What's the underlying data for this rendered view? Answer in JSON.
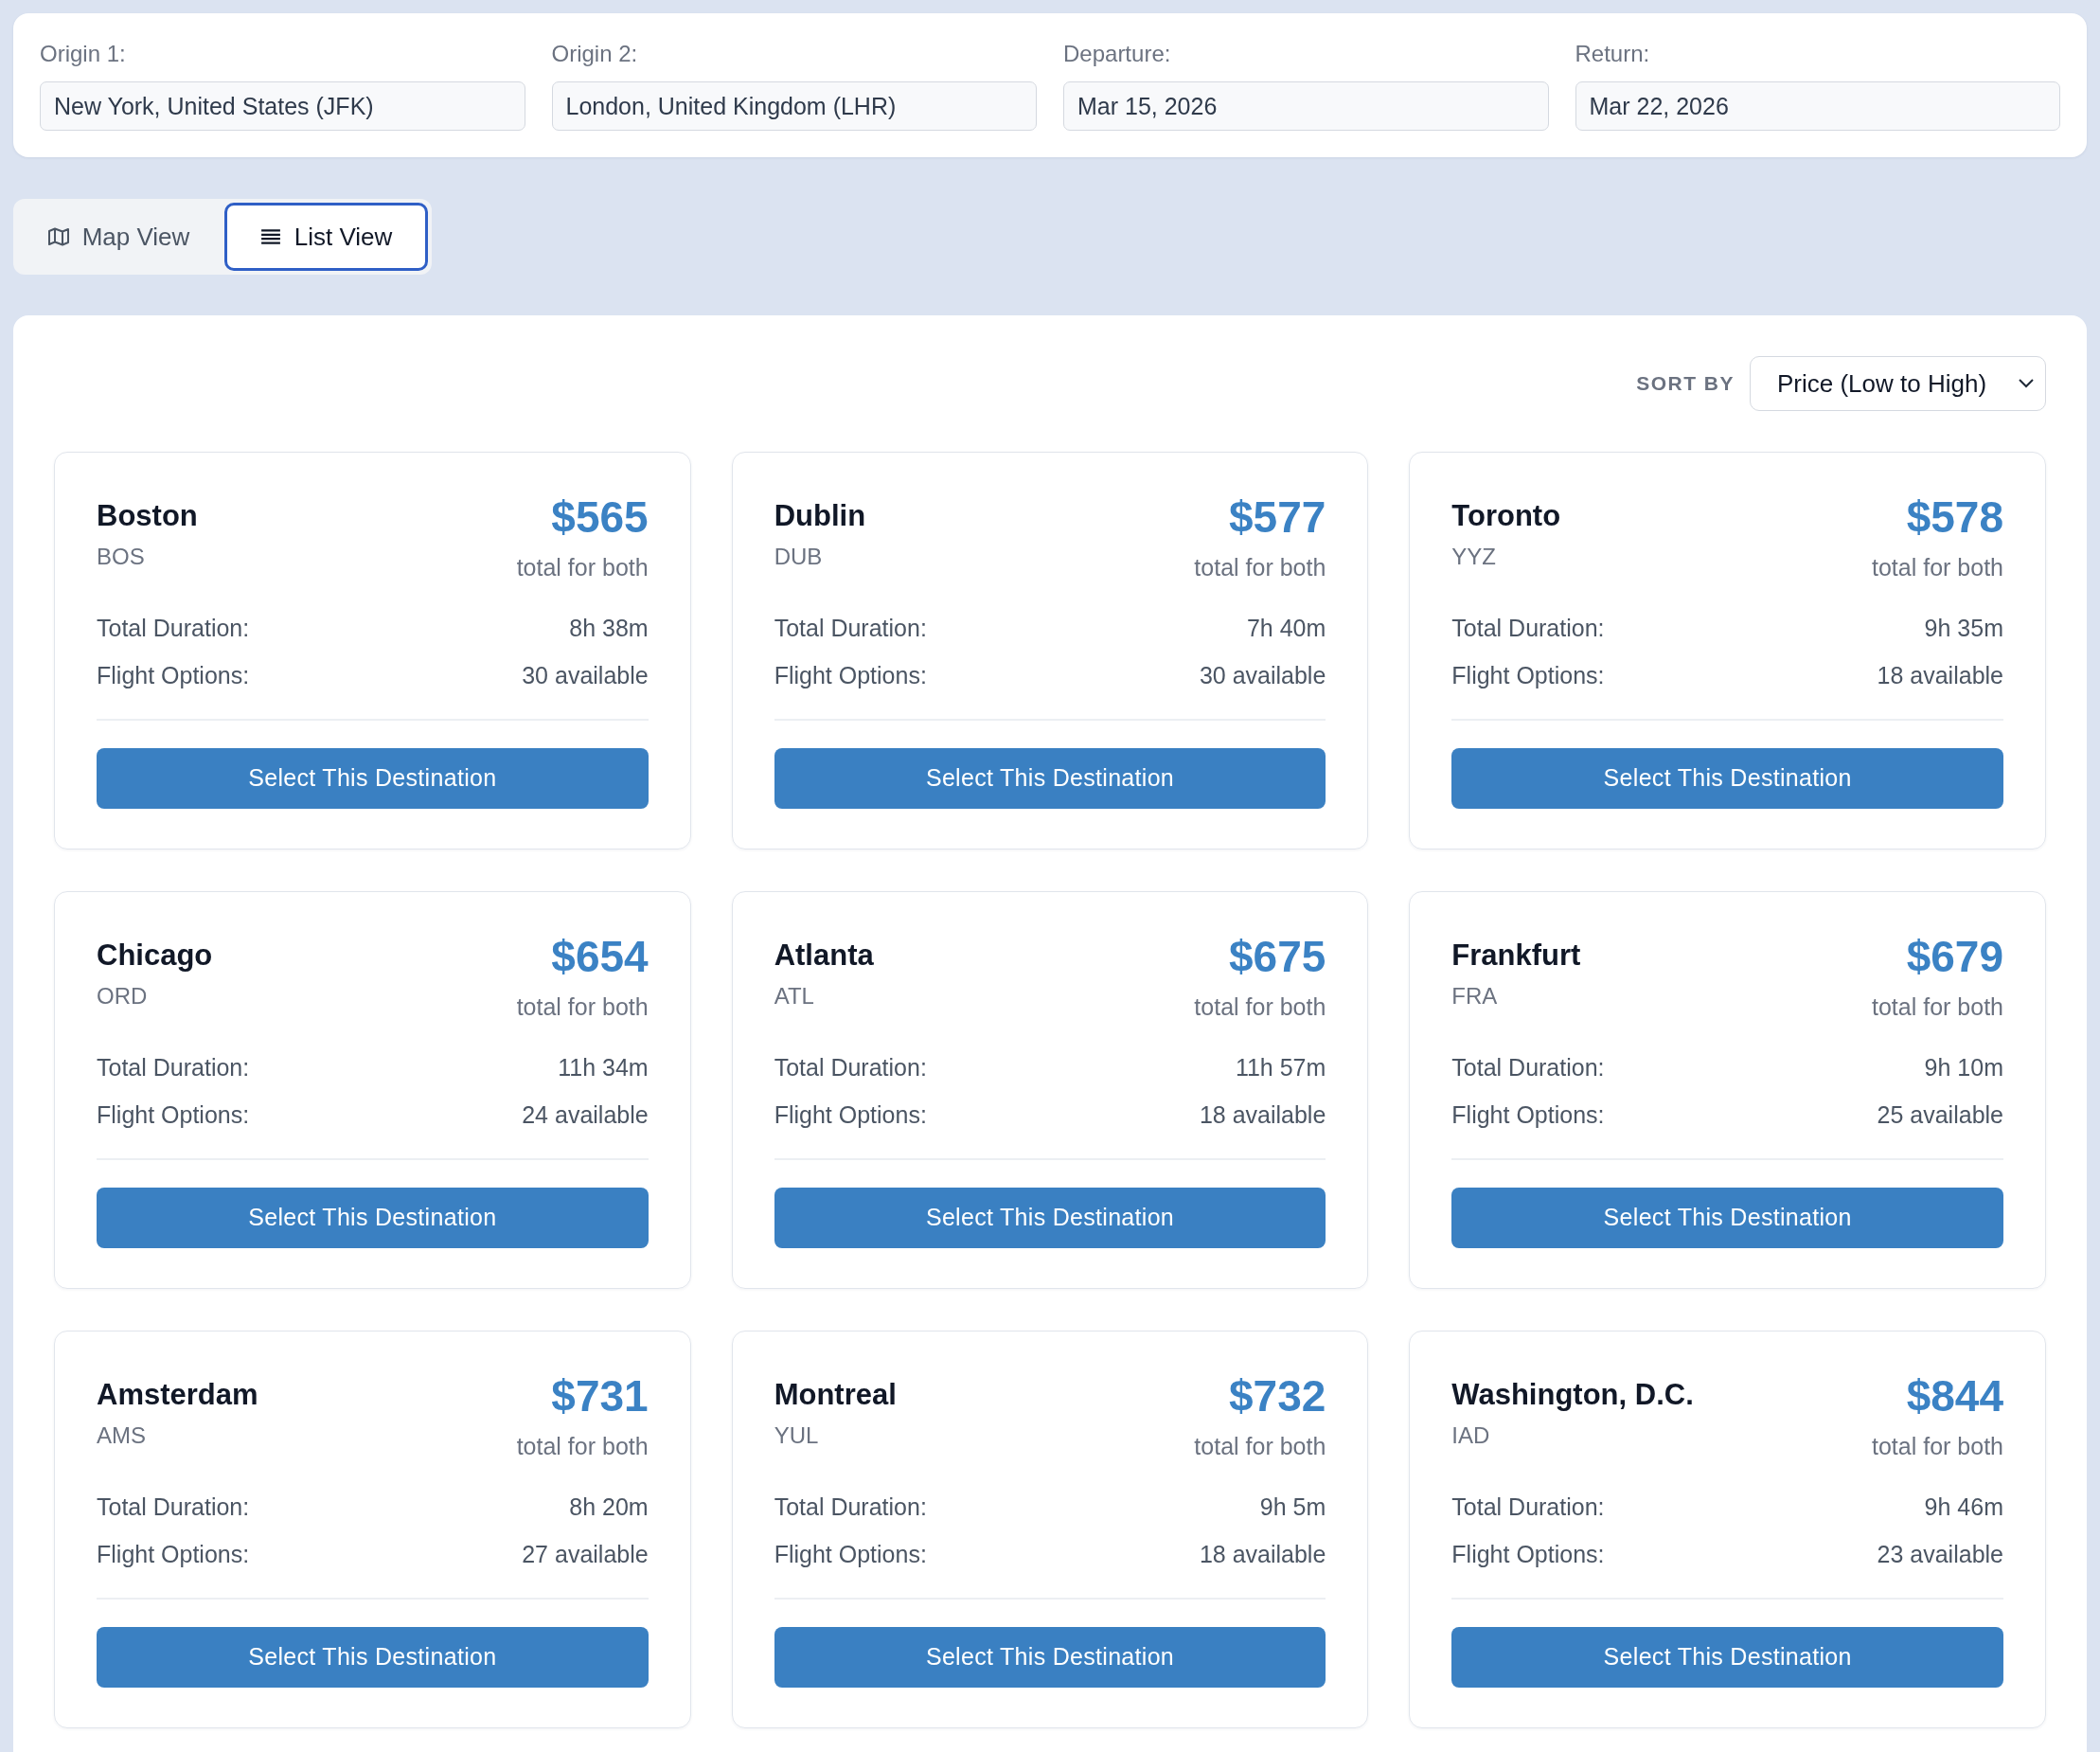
{
  "search": {
    "fields": [
      {
        "label": "Origin 1:",
        "value": "New York, United States (JFK)"
      },
      {
        "label": "Origin 2:",
        "value": "London, United Kingdom (LHR)"
      },
      {
        "label": "Departure:",
        "value": "Mar 15, 2026"
      },
      {
        "label": "Return:",
        "value": "Mar 22, 2026"
      }
    ]
  },
  "view_toggle": [
    {
      "kind": "map",
      "label": "Map View",
      "selected": false
    },
    {
      "kind": "list",
      "label": "List View",
      "selected": true
    }
  ],
  "sort": {
    "label": "SORT BY",
    "value": "Price (Low to High)"
  },
  "destinations": [
    {
      "city": "Boston",
      "code": "BOS",
      "price": "$565",
      "price_note": "total for both",
      "details": [
        {
          "label": "Total Duration:",
          "value": "8h 38m"
        },
        {
          "label": "Flight Options:",
          "value": "30 available"
        }
      ],
      "button": "Select This Destination"
    },
    {
      "city": "Dublin",
      "code": "DUB",
      "price": "$577",
      "price_note": "total for both",
      "details": [
        {
          "label": "Total Duration:",
          "value": "7h 40m"
        },
        {
          "label": "Flight Options:",
          "value": "30 available"
        }
      ],
      "button": "Select This Destination"
    },
    {
      "city": "Toronto",
      "code": "YYZ",
      "price": "$578",
      "price_note": "total for both",
      "details": [
        {
          "label": "Total Duration:",
          "value": "9h 35m"
        },
        {
          "label": "Flight Options:",
          "value": "18 available"
        }
      ],
      "button": "Select This Destination"
    },
    {
      "city": "Chicago",
      "code": "ORD",
      "price": "$654",
      "price_note": "total for both",
      "details": [
        {
          "label": "Total Duration:",
          "value": "11h 34m"
        },
        {
          "label": "Flight Options:",
          "value": "24 available"
        }
      ],
      "button": "Select This Destination"
    },
    {
      "city": "Atlanta",
      "code": "ATL",
      "price": "$675",
      "price_note": "total for both",
      "details": [
        {
          "label": "Total Duration:",
          "value": "11h 57m"
        },
        {
          "label": "Flight Options:",
          "value": "18 available"
        }
      ],
      "button": "Select This Destination"
    },
    {
      "city": "Frankfurt",
      "code": "FRA",
      "price": "$679",
      "price_note": "total for both",
      "details": [
        {
          "label": "Total Duration:",
          "value": "9h 10m"
        },
        {
          "label": "Flight Options:",
          "value": "25 available"
        }
      ],
      "button": "Select This Destination"
    },
    {
      "city": "Amsterdam",
      "code": "AMS",
      "price": "$731",
      "price_note": "total for both",
      "details": [
        {
          "label": "Total Duration:",
          "value": "8h 20m"
        },
        {
          "label": "Flight Options:",
          "value": "27 available"
        }
      ],
      "button": "Select This Destination"
    },
    {
      "city": "Montreal",
      "code": "YUL",
      "price": "$732",
      "price_note": "total for both",
      "details": [
        {
          "label": "Total Duration:",
          "value": "9h 5m"
        },
        {
          "label": "Flight Options:",
          "value": "18 available"
        }
      ],
      "button": "Select This Destination"
    },
    {
      "city": "Washington, D.C.",
      "code": "IAD",
      "price": "$844",
      "price_note": "total for both",
      "details": [
        {
          "label": "Total Duration:",
          "value": "9h 46m"
        },
        {
          "label": "Flight Options:",
          "value": "23 available"
        }
      ],
      "button": "Select This Destination"
    }
  ]
}
